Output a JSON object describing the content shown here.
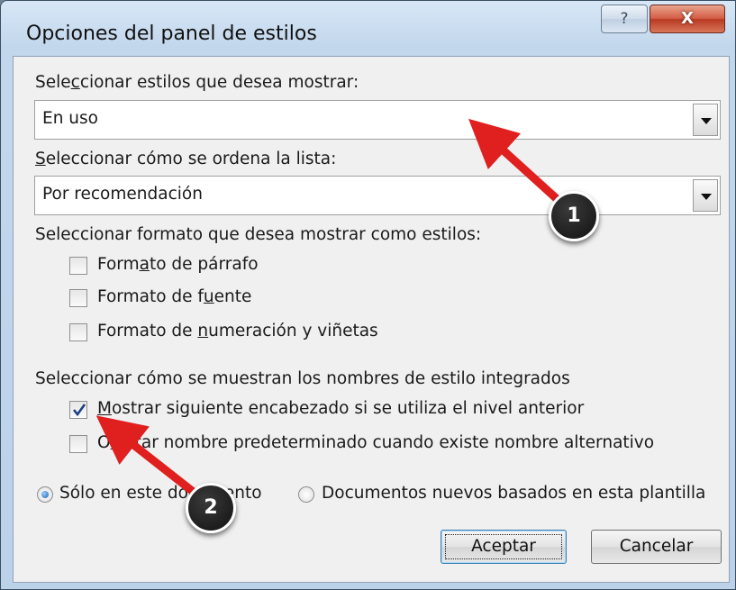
{
  "window": {
    "title": "Opciones del panel de estilos",
    "help": "?",
    "close": "X"
  },
  "section_show": {
    "label_before": "Sele",
    "label_accel": "c",
    "label_after": "cionar estilos que desea mostrar:",
    "value": "En uso"
  },
  "section_sort": {
    "label_accel": "S",
    "label_after": "eleccionar cómo se ordena la lista:",
    "value": "Por recomendación"
  },
  "section_format": {
    "label": "Seleccionar formato que desea mostrar como estilos:",
    "options": [
      {
        "before": "Form",
        "accel": "a",
        "after": "to de párrafo",
        "checked": false
      },
      {
        "before": "Formato de f",
        "accel": "u",
        "after": "ente",
        "checked": false
      },
      {
        "before": "Formato de ",
        "accel": "n",
        "after": "umeración y viñetas",
        "checked": false
      }
    ]
  },
  "section_builtin": {
    "label": "Seleccionar cómo se muestran los nombres de estilo integrados",
    "options": [
      {
        "before": "",
        "accel": "M",
        "after": "ostrar siguiente encabezado si se utiliza el nivel anterior",
        "checked": true
      },
      {
        "before": "O",
        "accel": "c",
        "after": "ultar nombre predeterminado cuando existe nombre alternativo",
        "checked": false
      }
    ]
  },
  "scope": {
    "option1": "Sólo en este documento",
    "option2": "Documentos nuevos basados en esta plantilla",
    "selected": "option1"
  },
  "buttons": {
    "ok": "Aceptar",
    "cancel": "Cancelar"
  },
  "annotations": {
    "badge1": "1",
    "badge2": "2",
    "color": "#e01f1f"
  }
}
